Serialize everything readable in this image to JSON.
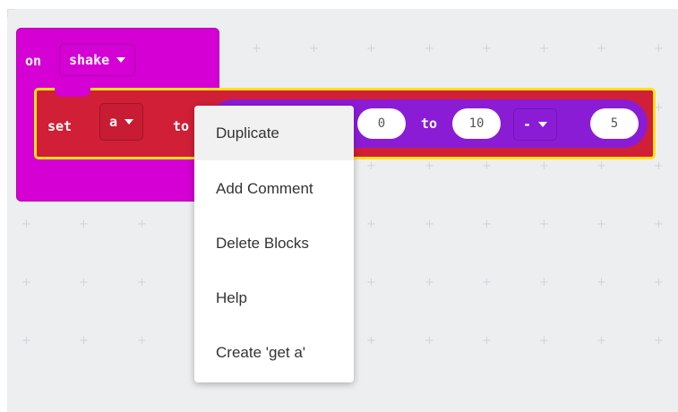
{
  "event_block": {
    "on_label": "on",
    "event_value": "shake"
  },
  "set_block": {
    "set_label": "set",
    "variable": "a",
    "to_label": "to"
  },
  "random_block": {
    "from_value": "0",
    "to_label": "to",
    "to_value": "10",
    "operator": "-",
    "operand": "5"
  },
  "context_menu": {
    "items": [
      {
        "label": "Duplicate"
      },
      {
        "label": "Add Comment"
      },
      {
        "label": "Delete Blocks"
      },
      {
        "label": "Help"
      },
      {
        "label": "Create 'get a'"
      }
    ]
  },
  "colors": {
    "event_block": "#d400d4",
    "set_block": "#d01f37",
    "random_block": "#8b1cd6",
    "selection_outline": "#ffe21a",
    "workspace": "#eceef0"
  }
}
